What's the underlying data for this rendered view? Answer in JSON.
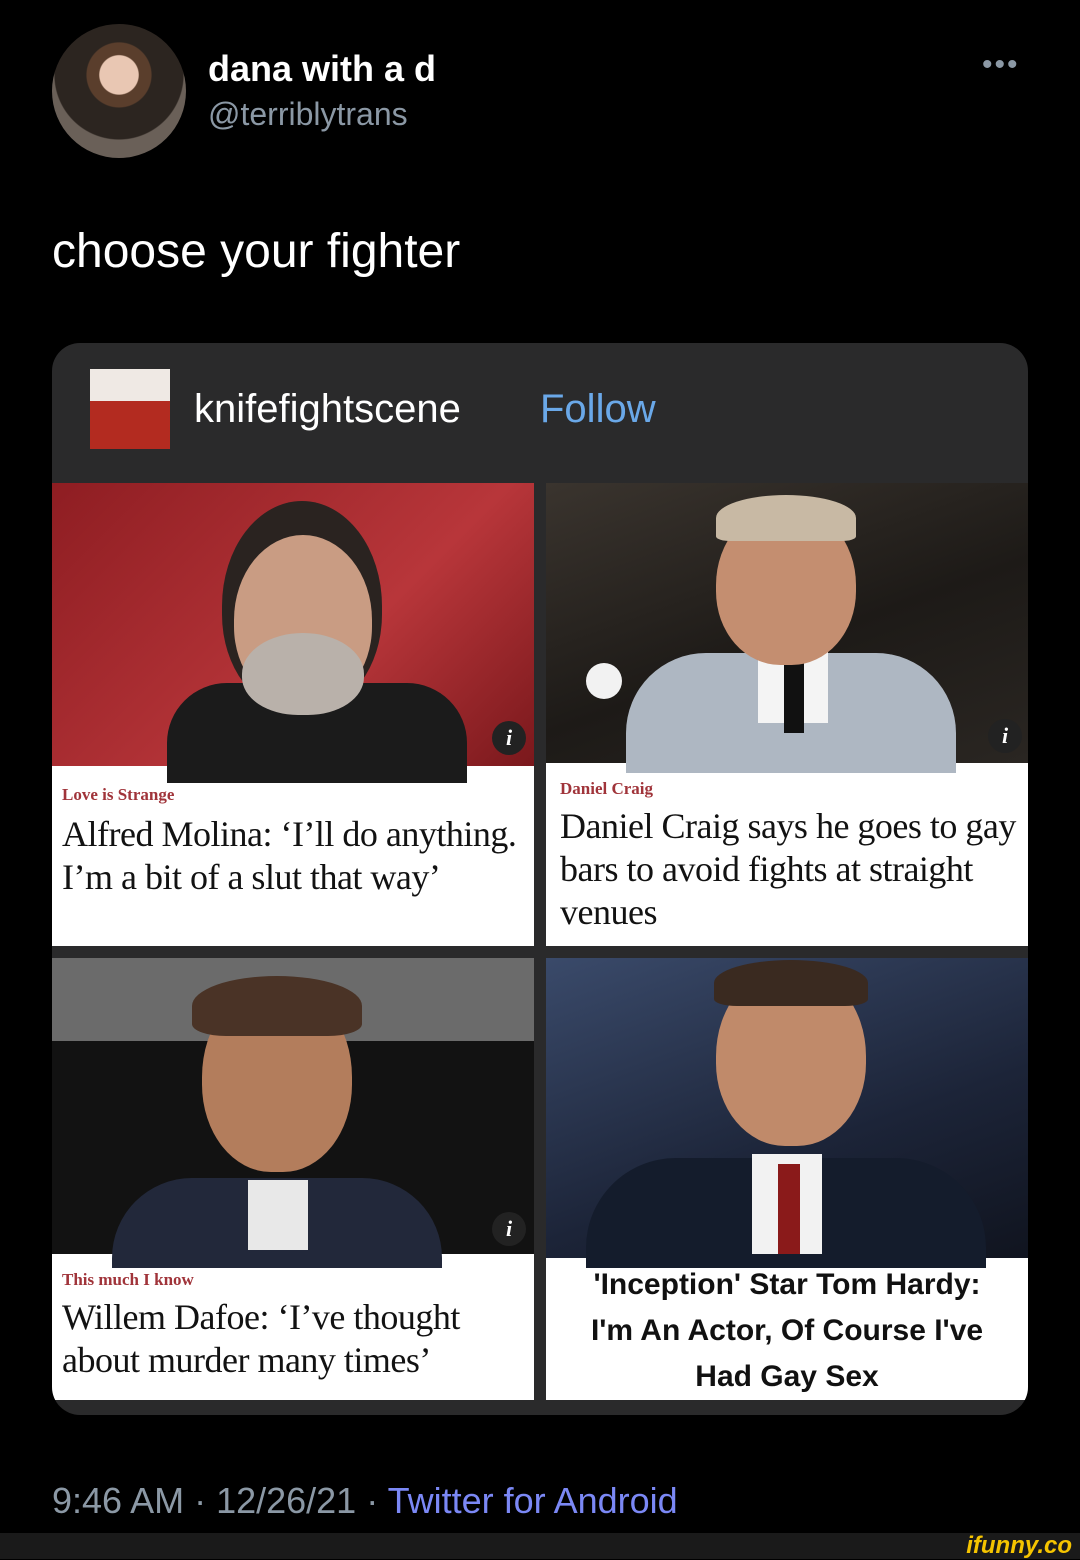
{
  "author": {
    "display_name": "dana with a d",
    "handle": "@terriblytrans"
  },
  "more_glyph": "•••",
  "tweet_text": "choose your fighter",
  "embedded_post": {
    "blog_name": "knifefightscene",
    "follow_label": "Follow",
    "tiles": [
      {
        "kicker": "Love is Strange",
        "headline": "Alfred Molina: ‘I’ll do anything. I’m a bit of a slut that way’",
        "info": "i"
      },
      {
        "kicker": "Daniel Craig",
        "headline": "Daniel Craig says he goes to gay bars to avoid fights at straight venues",
        "info": "i"
      },
      {
        "kicker": "This much I know",
        "headline": "Willem Dafoe: ‘I’ve thought about murder many times’",
        "info": "i"
      },
      {
        "headline": "'Inception' Star Tom Hardy: I'm An Actor, Of Course I've Had Gay Sex"
      }
    ]
  },
  "meta": {
    "time": "9:46 AM · 12/26/21 · ",
    "app": "Twitter for Android"
  },
  "watermark": "ifunny.co",
  "colors": {
    "background": "#000000",
    "card": "#2a2a2b",
    "secondary_text": "#8b98a5",
    "follow_link": "#6aa8e8",
    "app_link": "#7b88f5",
    "kicker": "#a0343a"
  }
}
